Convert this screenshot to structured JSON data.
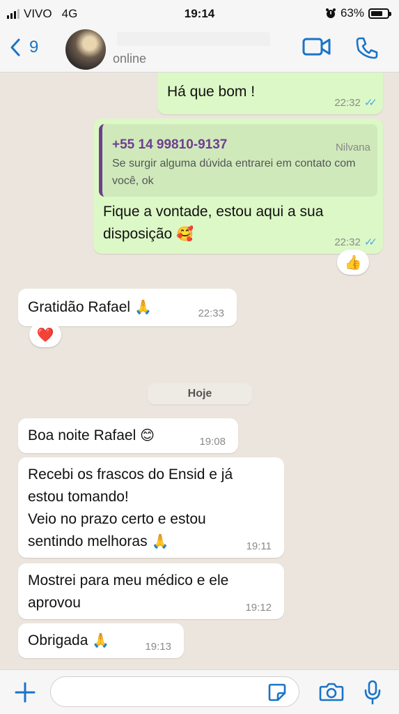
{
  "status_bar": {
    "carrier": "VIVO",
    "network": "4G",
    "time": "19:14",
    "battery": "63%"
  },
  "header": {
    "back_count": "9",
    "contact_status": "online"
  },
  "messages": [
    {
      "text": "Há que bom !",
      "time": "22:32"
    },
    {
      "quote_number": "+55 14 99810-9137",
      "quote_author": "Nilvana",
      "quote_text": "Se surgir alguma dúvida entrarei em contato com você, ok",
      "text_line1": "Fique a vontade, estou aqui a sua",
      "text_line2": "disposição",
      "emoji": "🥰",
      "time": "22:32",
      "reaction": "👍"
    },
    {
      "text": "Gratidão  Rafael",
      "emoji": "🙏",
      "time": "22:33",
      "reaction": "❤️"
    },
    {
      "text": "Boa noite Rafael",
      "emoji": "😊",
      "time": "19:08"
    },
    {
      "line1": "Recebi os frascos do Ensid e já",
      "line2": "estou tomando!",
      "line3": "Veio no prazo certo e estou",
      "line4": "sentindo melhoras",
      "emoji": "🙏",
      "time": "19:11"
    },
    {
      "line1": "Mostrei para meu médico e ele",
      "line2": "aprovou",
      "time": "19:12"
    },
    {
      "text": "Obrigada",
      "emoji": "🙏",
      "time": "19:13"
    }
  ],
  "day_separator": "Hoje",
  "input": {
    "placeholder": ""
  },
  "colors": {
    "accent": "#1a73c8",
    "outgoing": "#dcf8c6",
    "incoming": "#ffffff",
    "read_ticks": "#4fa9e6",
    "quote_bar": "#6e3e8f"
  }
}
